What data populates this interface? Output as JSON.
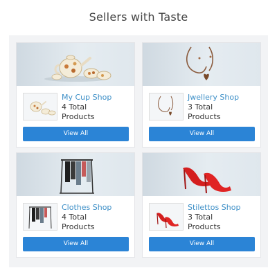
{
  "page": {
    "title": "Sellers with Taste"
  },
  "shops": [
    {
      "name": "My Cup Shop",
      "total_line1": "4 Total",
      "total_line2": "Products",
      "button": "View All",
      "image": "teapot-cups-icon"
    },
    {
      "name": "Jwellery Shop",
      "total_line1": "3 Total",
      "total_line2": "Products",
      "button": "View All",
      "image": "heart-necklace-icon"
    },
    {
      "name": "Clothes Shop",
      "total_line1": "4 Total",
      "total_line2": "Products",
      "button": "View All",
      "image": "clothes-rack-icon"
    },
    {
      "name": "Stilettos Shop",
      "total_line1": "3 Total",
      "total_line2": "Products",
      "button": "View All",
      "image": "red-stilettos-icon"
    }
  ],
  "colors": {
    "accent": "#2b84d6",
    "link": "#3d8fc7",
    "panel": "#f2f3f5"
  }
}
